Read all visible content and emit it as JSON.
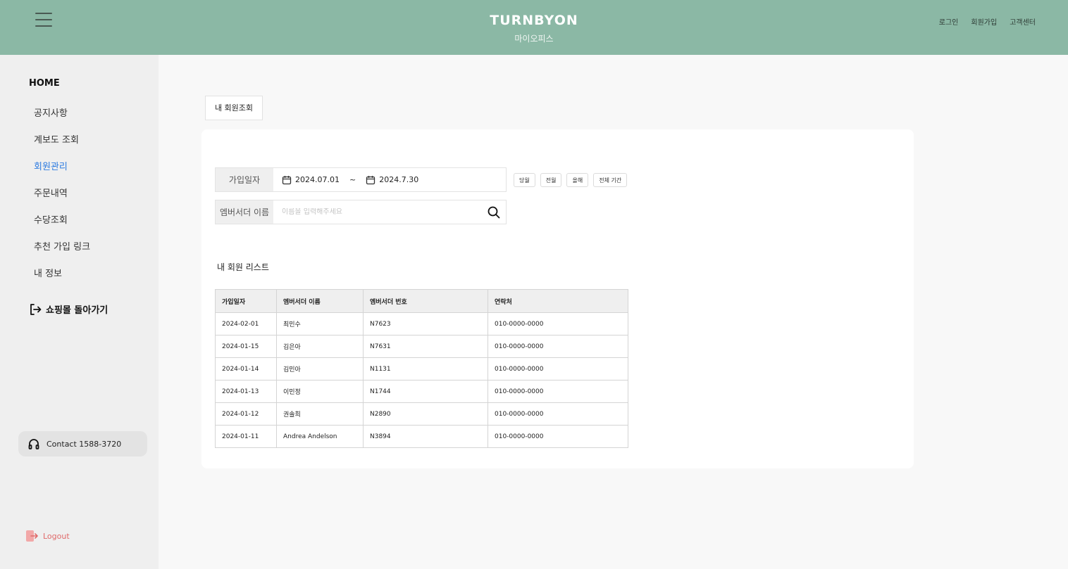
{
  "header": {
    "logo": "TURNBYON",
    "subtitle": "마이오피스",
    "links": [
      "로그인",
      "회원가입",
      "고객센터"
    ]
  },
  "sidebar": {
    "home": "HOME",
    "items": [
      {
        "label": "공지사항"
      },
      {
        "label": "계보도 조회"
      },
      {
        "label": "회원관리",
        "active": true
      },
      {
        "label": "주문내역"
      },
      {
        "label": "수당조회"
      },
      {
        "label": "추천 가입 링크"
      },
      {
        "label": "내 정보"
      }
    ],
    "back_to_mall": "쇼핑몰 돌아가기",
    "contact": "Contact 1588-3720",
    "logout": "Logout"
  },
  "main": {
    "tab": "내 회원조회",
    "filter": {
      "date_label": "가입일자",
      "start_date": "2024.07.01",
      "tilde": "~",
      "end_date": "2024.7.30",
      "name_label": "엠버서더 이름",
      "name_placeholder": "이름을 입력해주세요",
      "quick_buttons": [
        "당월",
        "전월",
        "올해",
        "전체 기간"
      ]
    },
    "list_title": "내 회원 리스트",
    "table": {
      "headers": [
        "가입일자",
        "엠버서더 이름",
        "엠버서더 번호",
        "연락처"
      ],
      "rows": [
        [
          "2024-02-01",
          "최민수",
          "N7623",
          "010-0000-0000"
        ],
        [
          "2024-01-15",
          "김은아",
          "N7631",
          "010-0000-0000"
        ],
        [
          "2024-01-14",
          "김민아",
          "N1131",
          "010-0000-0000"
        ],
        [
          "2024-01-13",
          "이민정",
          "N1744",
          "010-0000-0000"
        ],
        [
          "2024-01-12",
          "권솔희",
          "N2890",
          "010-0000-0000"
        ],
        [
          "2024-01-11",
          "Andrea Andelson",
          "N3894",
          "010-0000-0000"
        ]
      ]
    }
  },
  "colors": {
    "header_bg": "#8bb8a5",
    "active_nav": "#2d7be0",
    "logout": "#e06a6a"
  }
}
